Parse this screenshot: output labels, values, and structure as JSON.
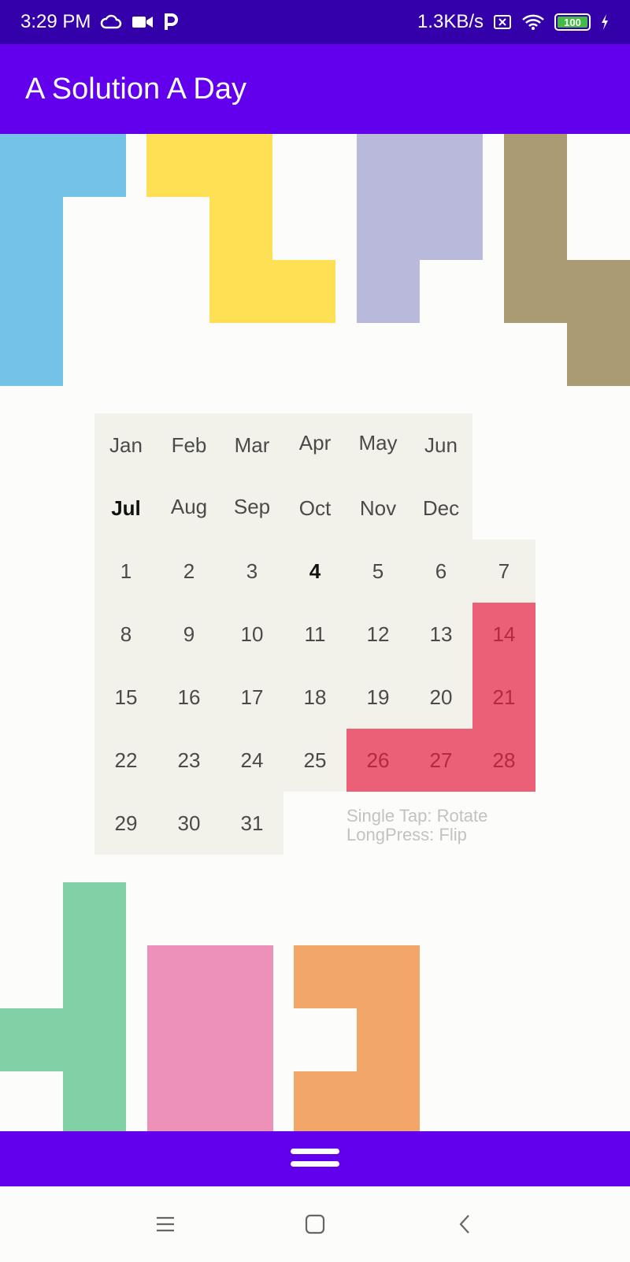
{
  "status_bar": {
    "time": "3:29 PM",
    "speed": "1.3KB/s",
    "battery": "100",
    "icons_left": [
      "cloud-icon",
      "video-icon",
      "p-icon"
    ],
    "icons_right": [
      "sim-icon",
      "wifi-icon",
      "battery-icon",
      "charging-icon"
    ]
  },
  "app": {
    "title": "A Solution A Day"
  },
  "colors": {
    "app_bar": "#6200ee",
    "status_bar": "#3300aa",
    "board": "#f3f2ea",
    "blue_piece": "#74c2e6",
    "yellow_piece": "#ffe055",
    "lavender_piece": "#b9b9db",
    "olive_piece": "#aa9b72",
    "red_piece": "#eb6077",
    "green_piece": "#81d0a6",
    "pink_piece": "#ee91b8",
    "orange_piece": "#f2a66a"
  },
  "calendar": {
    "months_row1": [
      "Jan",
      "Feb",
      "Mar",
      "Apr",
      "May",
      "Jun"
    ],
    "months_row2": [
      "Jul",
      "Aug",
      "Sep",
      "Oct",
      "Nov",
      "Dec"
    ],
    "days_row1": [
      "1",
      "2",
      "3",
      "4",
      "5",
      "6",
      "7"
    ],
    "days_row2": [
      "8",
      "9",
      "10",
      "11",
      "12",
      "13",
      "14"
    ],
    "days_row3": [
      "15",
      "16",
      "17",
      "18",
      "19",
      "20",
      "21"
    ],
    "days_row4": [
      "22",
      "23",
      "24",
      "25",
      "26",
      "27",
      "28"
    ],
    "days_row5": [
      "29",
      "30",
      "31"
    ],
    "selected_month": "Jul",
    "selected_day": "4"
  },
  "hint": {
    "line1": "Single Tap: Rotate",
    "line2": "LongPress: Flip"
  },
  "nav": {
    "icons": [
      "recents-icon",
      "home-icon",
      "back-icon"
    ]
  }
}
